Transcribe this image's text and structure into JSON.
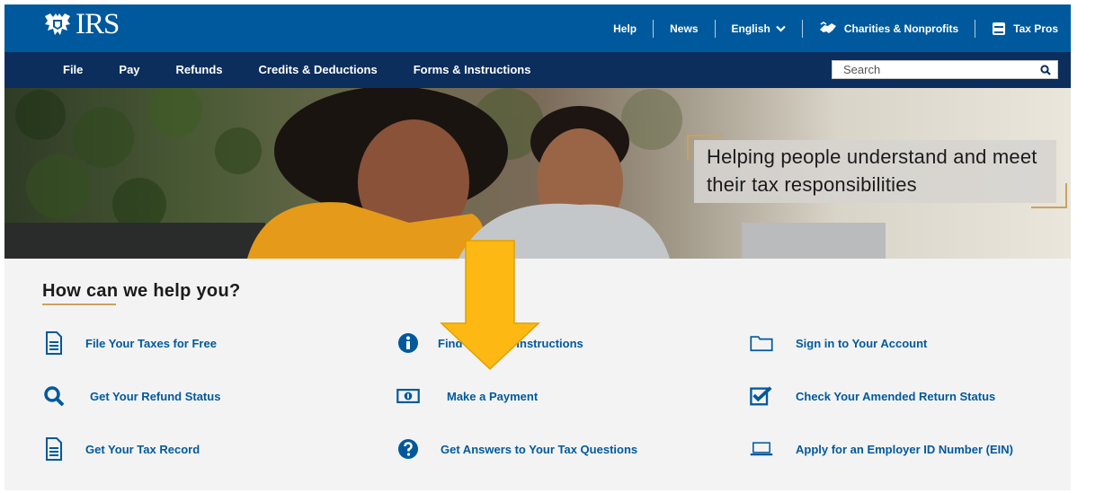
{
  "header": {
    "logo_text": "IRS",
    "utility_links": {
      "help": "Help",
      "news": "News",
      "language": "English",
      "charities": "Charities & Nonprofits",
      "tax_pros": "Tax Pros"
    }
  },
  "nav": {
    "items": [
      "File",
      "Pay",
      "Refunds",
      "Credits & Deductions",
      "Forms & Instructions"
    ],
    "search_placeholder": "Search"
  },
  "hero": {
    "tagline": "Helping people understand and meet their tax responsibilities"
  },
  "help": {
    "title": "How can we help you?",
    "links": [
      {
        "label": "File Your Taxes for Free",
        "icon": "document-icon"
      },
      {
        "label": "Find Forms & Instructions",
        "icon": "info-circle-icon"
      },
      {
        "label": "Sign in to Your Account",
        "icon": "folder-icon"
      },
      {
        "label": "Get Your Refund Status",
        "icon": "search-icon"
      },
      {
        "label": "Make a Payment",
        "icon": "money-bill-icon"
      },
      {
        "label": "Check Your Amended Return Status",
        "icon": "checkbox-icon"
      },
      {
        "label": "Get Your Tax Record",
        "icon": "document-icon"
      },
      {
        "label": "Get Answers to Your Tax Questions",
        "icon": "question-circle-icon"
      },
      {
        "label": "Apply for an Employer ID Number (EIN)",
        "icon": "laptop-icon"
      }
    ]
  },
  "colors": {
    "brand_blue": "#00599c",
    "nav_navy": "#0b2e5c",
    "accent_gold": "#c9a35e",
    "arrow_yellow": "#fdb813"
  }
}
